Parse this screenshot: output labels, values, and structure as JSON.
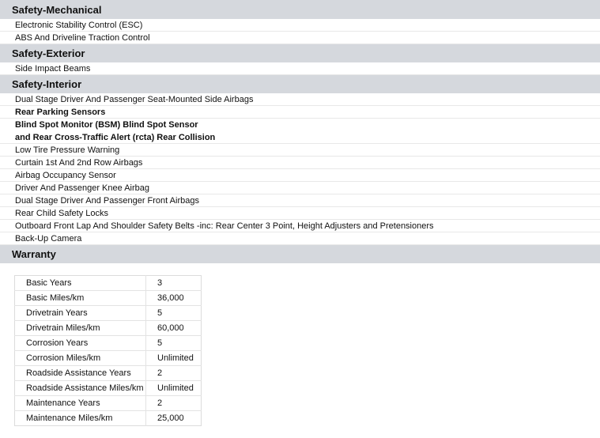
{
  "sections": {
    "mechanical": {
      "title": "Safety-Mechanical",
      "items": [
        "Electronic Stability Control (ESC)",
        "ABS And Driveline Traction Control"
      ]
    },
    "exterior": {
      "title": "Safety-Exterior",
      "items": [
        "Side Impact Beams"
      ]
    },
    "interior": {
      "title": "Safety-Interior",
      "items": [
        "Dual Stage Driver And Passenger Seat-Mounted Side Airbags",
        "Rear Parking Sensors",
        "Blind Spot Monitor (BSM) Blind Spot Sensor",
        "and Rear Cross-Traffic Alert (rcta) Rear Collision",
        "Low Tire Pressure Warning",
        "Curtain 1st And 2nd Row Airbags",
        "Airbag Occupancy Sensor",
        "Driver And Passenger Knee Airbag",
        "Dual Stage Driver And Passenger Front Airbags",
        "Rear Child Safety Locks",
        "Outboard Front Lap And Shoulder Safety Belts -inc: Rear Center 3 Point, Height Adjusters and Pretensioners",
        "Back-Up Camera"
      ]
    },
    "warranty": {
      "title": "Warranty",
      "rows": [
        {
          "label": "Basic Years",
          "value": "3"
        },
        {
          "label": "Basic Miles/km",
          "value": "36,000"
        },
        {
          "label": "Drivetrain Years",
          "value": "5"
        },
        {
          "label": "Drivetrain Miles/km",
          "value": "60,000"
        },
        {
          "label": "Corrosion Years",
          "value": "5"
        },
        {
          "label": "Corrosion Miles/km",
          "value": "Unlimited"
        },
        {
          "label": "Roadside Assistance Years",
          "value": "2"
        },
        {
          "label": "Roadside Assistance Miles/km",
          "value": "Unlimited"
        },
        {
          "label": "Maintenance Years",
          "value": "2"
        },
        {
          "label": "Maintenance Miles/km",
          "value": "25,000"
        }
      ]
    }
  }
}
